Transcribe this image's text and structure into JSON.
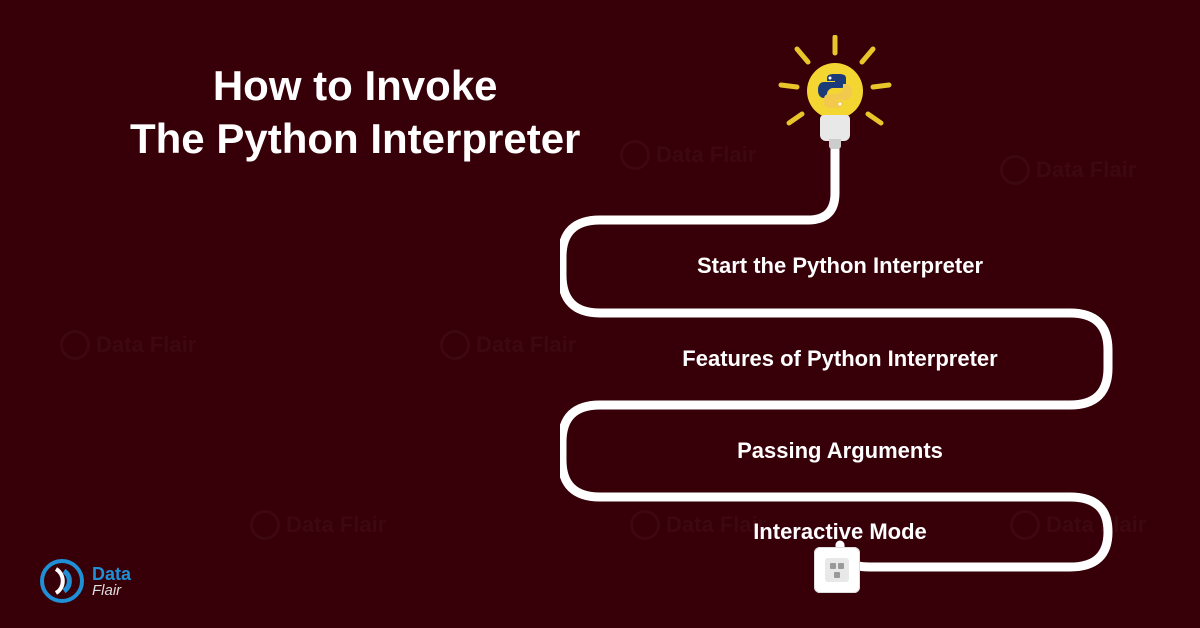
{
  "title_line1": "How to Invoke",
  "title_line2": "The Python Interpreter",
  "labels": {
    "l1": "Start the Python Interpreter",
    "l2": "Features of Python Interpreter",
    "l3": "Passing Arguments",
    "l4": "Interactive Mode"
  },
  "logo": {
    "top": "Data",
    "bottom": "Flair"
  },
  "watermark": "Data Flair",
  "colors": {
    "background": "#370008",
    "wire": "#ffffff",
    "bulb": "#f4d633",
    "rays": "#e8c52a",
    "python_blue": "#1c3b7a",
    "python_yellow": "#f2c94c"
  }
}
